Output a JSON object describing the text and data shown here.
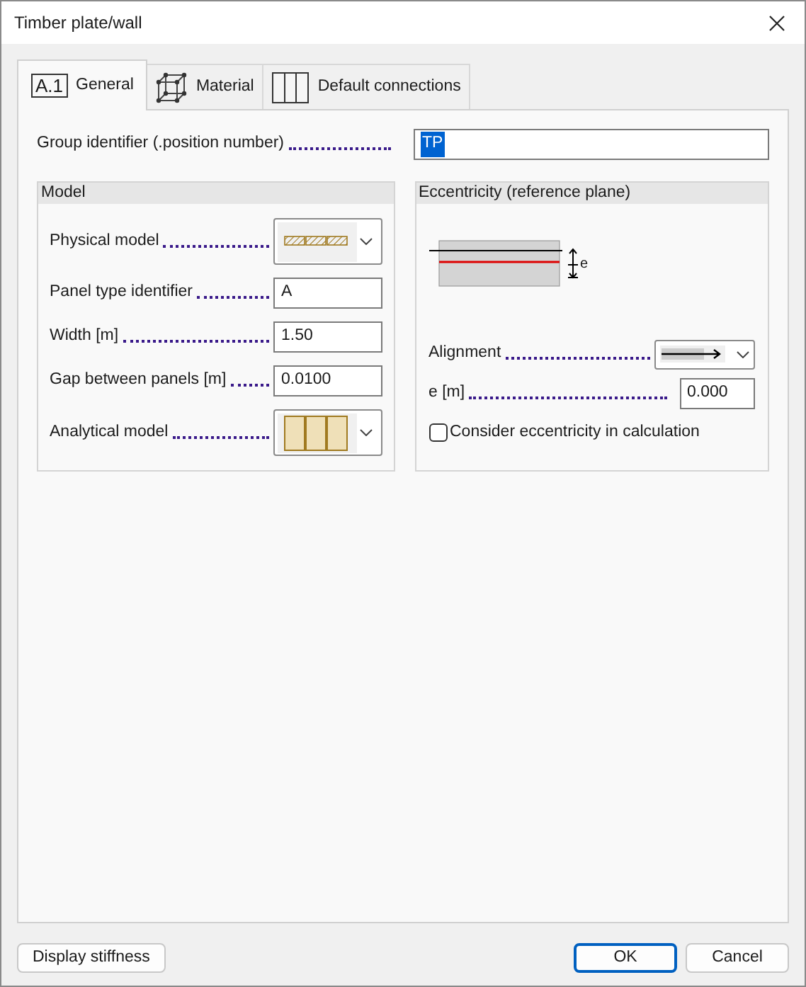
{
  "window": {
    "title": "Timber plate/wall"
  },
  "tabs": [
    {
      "icon": "A.1",
      "label": "General",
      "selected": true,
      "kind": "code"
    },
    {
      "label": "Material",
      "selected": false,
      "kind": "cube"
    },
    {
      "label": "Default connections",
      "selected": false,
      "kind": "panels"
    }
  ],
  "group_identifier": {
    "label": "Group identifier (.position number)",
    "value": "TP"
  },
  "model": {
    "title": "Model",
    "rows": [
      {
        "label": "Physical model",
        "kind": "hatch-combo"
      },
      {
        "label": "Panel type identifier",
        "kind": "text",
        "value": "A"
      },
      {
        "label": "Width [m]",
        "kind": "text",
        "value": "1.50"
      },
      {
        "label": "Gap between panels [m]",
        "kind": "text",
        "value": "0.0100"
      },
      {
        "label": "Analytical model",
        "kind": "panels-combo"
      }
    ]
  },
  "eccentricity": {
    "title": "Eccentricity (reference plane)",
    "diagram_label": "e",
    "alignment": {
      "label": "Alignment"
    },
    "e": {
      "label": "e [m]",
      "value": "0.000"
    },
    "consider": {
      "label": "Consider eccentricity in calculation",
      "checked": false
    }
  },
  "buttons": [
    {
      "label": "Display stiffness",
      "kind": "left"
    },
    {
      "label": "OK",
      "kind": "default"
    },
    {
      "label": "Cancel",
      "kind": "normal"
    }
  ]
}
